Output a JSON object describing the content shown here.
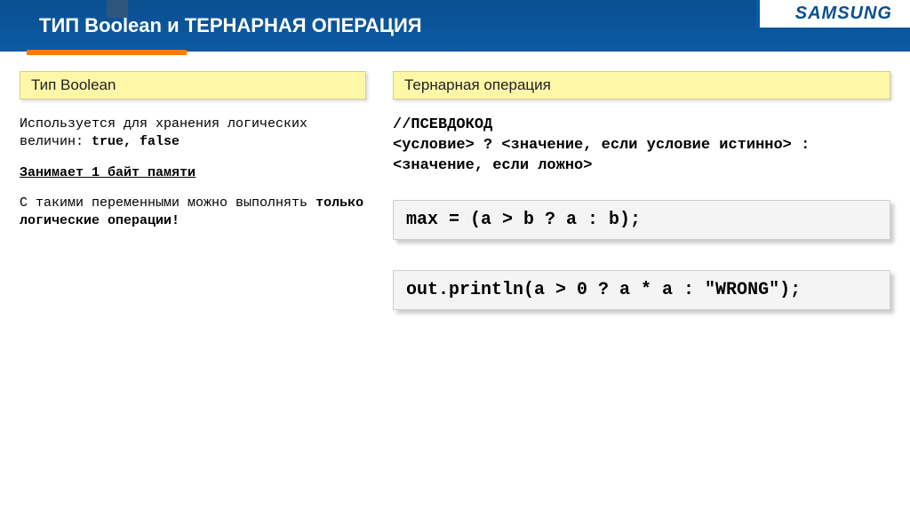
{
  "header": {
    "title": "ТИП Boolean и ТЕРНАРНАЯ ОПЕРАЦИЯ",
    "logo": "SAMSUNG"
  },
  "left": {
    "label": "Тип Boolean",
    "p1_prefix": "Используется для хранения логических величин: ",
    "p1_code": "true, false",
    "p2": "Занимает 1 байт памяти",
    "p3_prefix": "С такими переменными можно выполнять ",
    "p3_bold": "только логические операции!"
  },
  "right": {
    "label": "Тернарная операция",
    "pseudo_line1": "//ПСЕВДОКОД",
    "pseudo_line2": "<условие> ? <значение, если условие истинно> : <значение, если ложно>",
    "code1": "max = (a > b ? a : b);",
    "code2": "out.println(a > 0 ? a * a : \"WRONG\");"
  }
}
